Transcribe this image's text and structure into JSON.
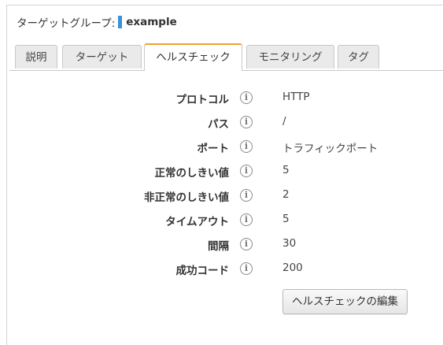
{
  "header": {
    "label": "ターゲットグループ:",
    "name": "example",
    "accent_color": "#3d8fd6"
  },
  "tabs": [
    {
      "label": "説明",
      "active": false
    },
    {
      "label": "ターゲット",
      "active": false
    },
    {
      "label": "ヘルスチェック",
      "active": true
    },
    {
      "label": "モニタリング",
      "active": false
    },
    {
      "label": "タグ",
      "active": false
    }
  ],
  "health_check": {
    "rows": [
      {
        "key": "プロトコル",
        "value": "HTTP"
      },
      {
        "key": "パス",
        "value": "/"
      },
      {
        "key": "ポート",
        "value": "トラフィックポート"
      },
      {
        "key": "正常のしきい値",
        "value": "5"
      },
      {
        "key": "非正常のしきい値",
        "value": "2"
      },
      {
        "key": "タイムアウト",
        "value": "5"
      },
      {
        "key": "間隔",
        "value": "30"
      },
      {
        "key": "成功コード",
        "value": "200"
      }
    ],
    "info_icon": "info-icon",
    "edit_button_label": "ヘルスチェックの編集"
  },
  "colors": {
    "active_tab_accent": "#f0a22e",
    "tab_background": "#eaeaea"
  }
}
